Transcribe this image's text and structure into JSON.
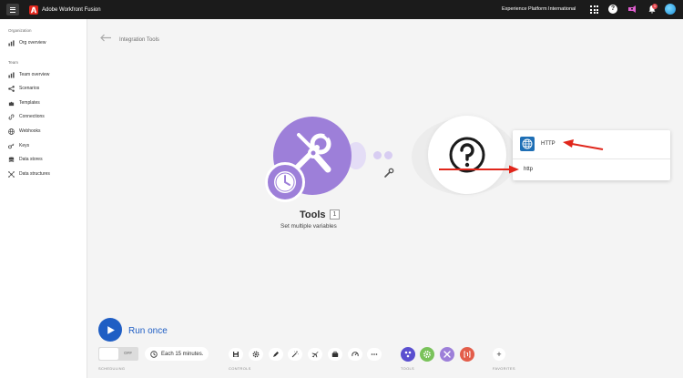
{
  "app": {
    "title": "Adobe Workfront Fusion",
    "org_name": "Experience Platform International",
    "notifications": "1"
  },
  "sidebar": {
    "organization_heading": "Organization",
    "team_heading": "Team",
    "org_items": [
      {
        "label": "Org overview",
        "icon": "chart-icon"
      }
    ],
    "team_items": [
      {
        "label": "Team overview",
        "icon": "chart-icon"
      },
      {
        "label": "Scenarios",
        "icon": "share-icon"
      },
      {
        "label": "Templates",
        "icon": "puzzle-icon"
      },
      {
        "label": "Connections",
        "icon": "link-icon"
      },
      {
        "label": "Webhooks",
        "icon": "globe-icon"
      },
      {
        "label": "Keys",
        "icon": "key-icon"
      },
      {
        "label": "Data stores",
        "icon": "database-icon"
      },
      {
        "label": "Data structures",
        "icon": "structure-icon"
      }
    ]
  },
  "breadcrumb": {
    "label": "Integration Tools"
  },
  "module": {
    "title": "Tools",
    "count": "1",
    "subtitle": "Set multiple variables"
  },
  "picker": {
    "result_label": "HTTP",
    "search_value": "http"
  },
  "footer": {
    "run_once": "Run once",
    "toggle": "OFF",
    "schedule": "Each 15 minutes.",
    "labels": {
      "scheduling": "SCHEDULING",
      "controls": "CONTROLS",
      "tools": "TOOLS",
      "favorites": "FAVORITES"
    }
  },
  "colors": {
    "accent": "#1f5ec4",
    "module": "#9d7fd9",
    "annotation": "#e0261b"
  }
}
